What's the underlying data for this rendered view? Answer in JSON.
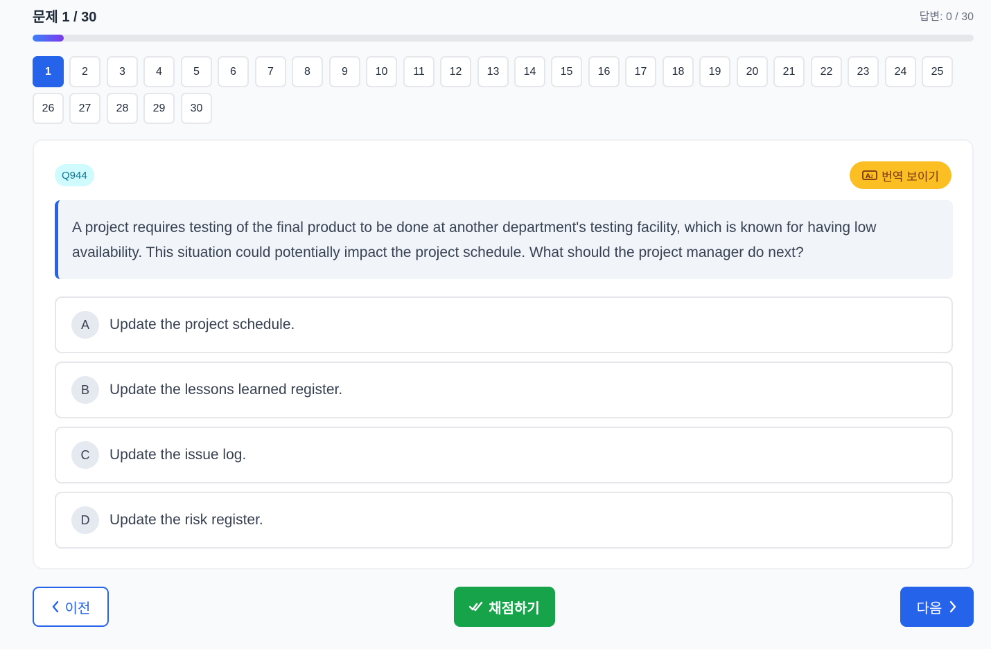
{
  "header": {
    "title": "문제 1 / 30",
    "answered": "답변: 0 / 30"
  },
  "progress": {
    "value": 1,
    "total": 30,
    "fraction": 0.0333
  },
  "question_nav": {
    "current": 1,
    "items": [
      "1",
      "2",
      "3",
      "4",
      "5",
      "6",
      "7",
      "8",
      "9",
      "10",
      "11",
      "12",
      "13",
      "14",
      "15",
      "16",
      "17",
      "18",
      "19",
      "20",
      "21",
      "22",
      "23",
      "24",
      "25",
      "26",
      "27",
      "28",
      "29",
      "30"
    ]
  },
  "question": {
    "id": "Q944",
    "translate_label": "번역 보이기",
    "text": "A project requires testing of the final product to be done at another department's testing facility, which is known for having low availability. This situation could potentially impact the project schedule. What should the project manager do next?",
    "options": [
      {
        "letter": "A",
        "text": "Update the project schedule."
      },
      {
        "letter": "B",
        "text": "Update the lessons learned register."
      },
      {
        "letter": "C",
        "text": "Update the issue log."
      },
      {
        "letter": "D",
        "text": "Update the risk register."
      }
    ]
  },
  "footer": {
    "prev_label": "이전",
    "grade_label": "채점하기",
    "next_label": "다음"
  },
  "colors": {
    "primary": "#2563eb",
    "success": "#16a34a",
    "warning": "#fbbf24",
    "badge": "#cffafe"
  },
  "icons": {
    "prev": "chevron-left-icon",
    "next": "chevron-right-icon",
    "grade": "double-check-icon",
    "translate": "translate-icon"
  }
}
